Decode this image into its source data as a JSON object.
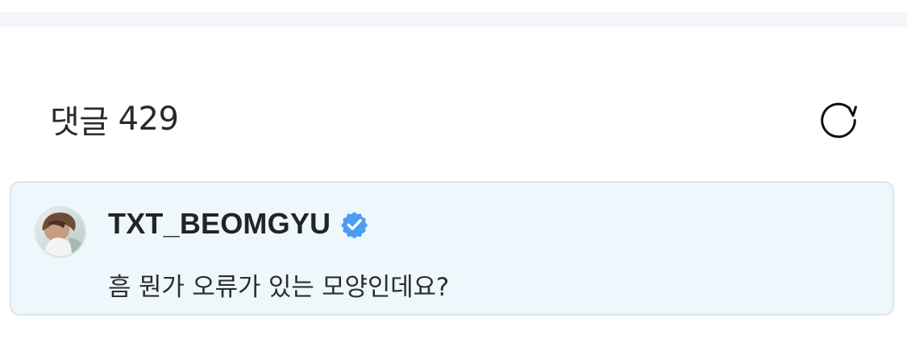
{
  "comments": {
    "label": "댓글",
    "count": "429",
    "refresh_icon": "refresh-icon"
  },
  "comment": {
    "author": "TXT_BEOMGYU",
    "verified_icon": "verified-badge-icon",
    "text": "흠 뭔가 오류가 있는 모양인데요?",
    "avatar_icon": "profile-avatar"
  },
  "colors": {
    "page_background": "#ffffff",
    "top_strip": "#f4f5f8",
    "comment_background": "#eef7fc",
    "comment_border": "#d8e6ee",
    "verified_blue": "#4c9cf2",
    "text_primary": "#242424"
  }
}
